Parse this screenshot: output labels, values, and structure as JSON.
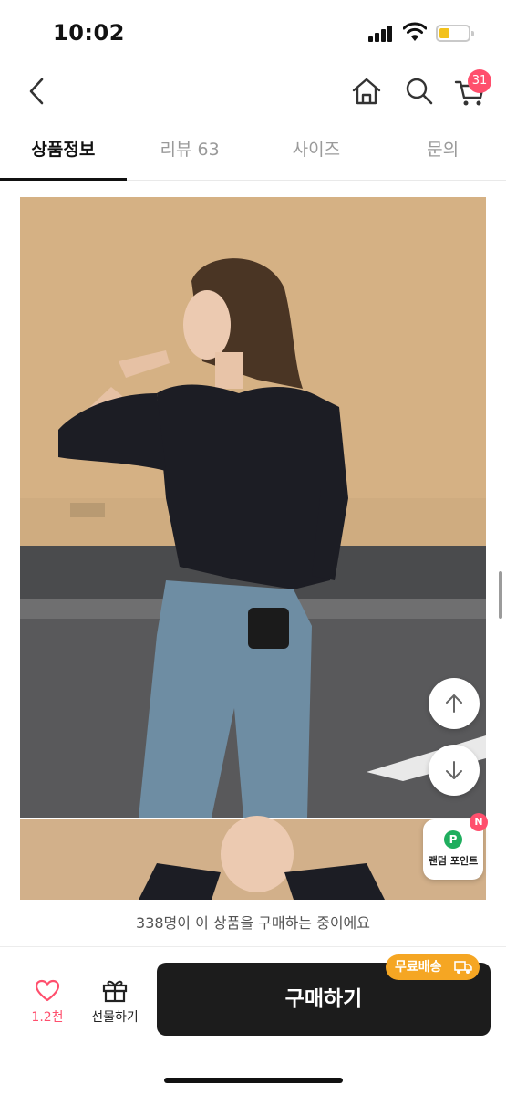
{
  "status_bar": {
    "time": "10:02"
  },
  "header": {
    "cart_count": "31"
  },
  "tabs": [
    {
      "label": "상품정보",
      "active": true
    },
    {
      "label": "리뷰 63",
      "active": false
    },
    {
      "label": "사이즈",
      "active": false
    },
    {
      "label": "문의",
      "active": false
    }
  ],
  "floating": {
    "random_point_label": "랜덤 포인트",
    "random_point_icon": "P",
    "new_badge": "N"
  },
  "bottom": {
    "buyer_notice": "338명이 이 상품을 구매하는 중이에요",
    "like_count": "1.2천",
    "gift_label": "선물하기",
    "buy_label": "구매하기",
    "free_shipping_label": "무료배송"
  },
  "colors": {
    "accent_pink": "#ff4f6d",
    "free_ship_orange": "#f5a623",
    "buy_button": "#1c1c1c"
  }
}
